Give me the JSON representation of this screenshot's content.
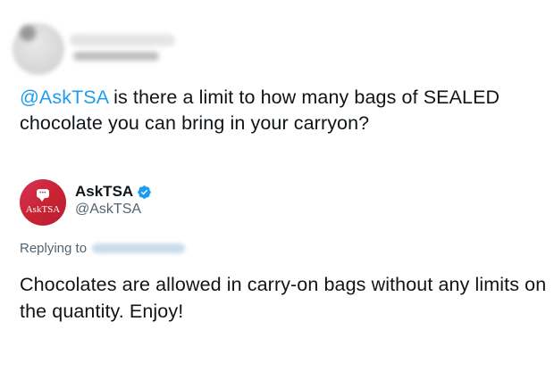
{
  "original_tweet": {
    "mention": "@AskTSA",
    "text": " is there a limit to how many bags of SEALED chocolate you can bring in your carryon?"
  },
  "reply": {
    "author_name": "AskTSA",
    "author_handle": "@AskTSA",
    "avatar_text": "AskTSA",
    "replying_label": "Replying to",
    "text": "Chocolates are allowed in carry-on bags without any limits on the quantity. Enjoy!"
  },
  "colors": {
    "mention": "#1d9bf0",
    "verified": "#1d9bf0",
    "avatar_bg": "#c8232f",
    "secondary_text": "#536471"
  },
  "icons": {
    "verified": "verified-badge-icon",
    "avatar_bubble": "chat-bubble-icon"
  }
}
